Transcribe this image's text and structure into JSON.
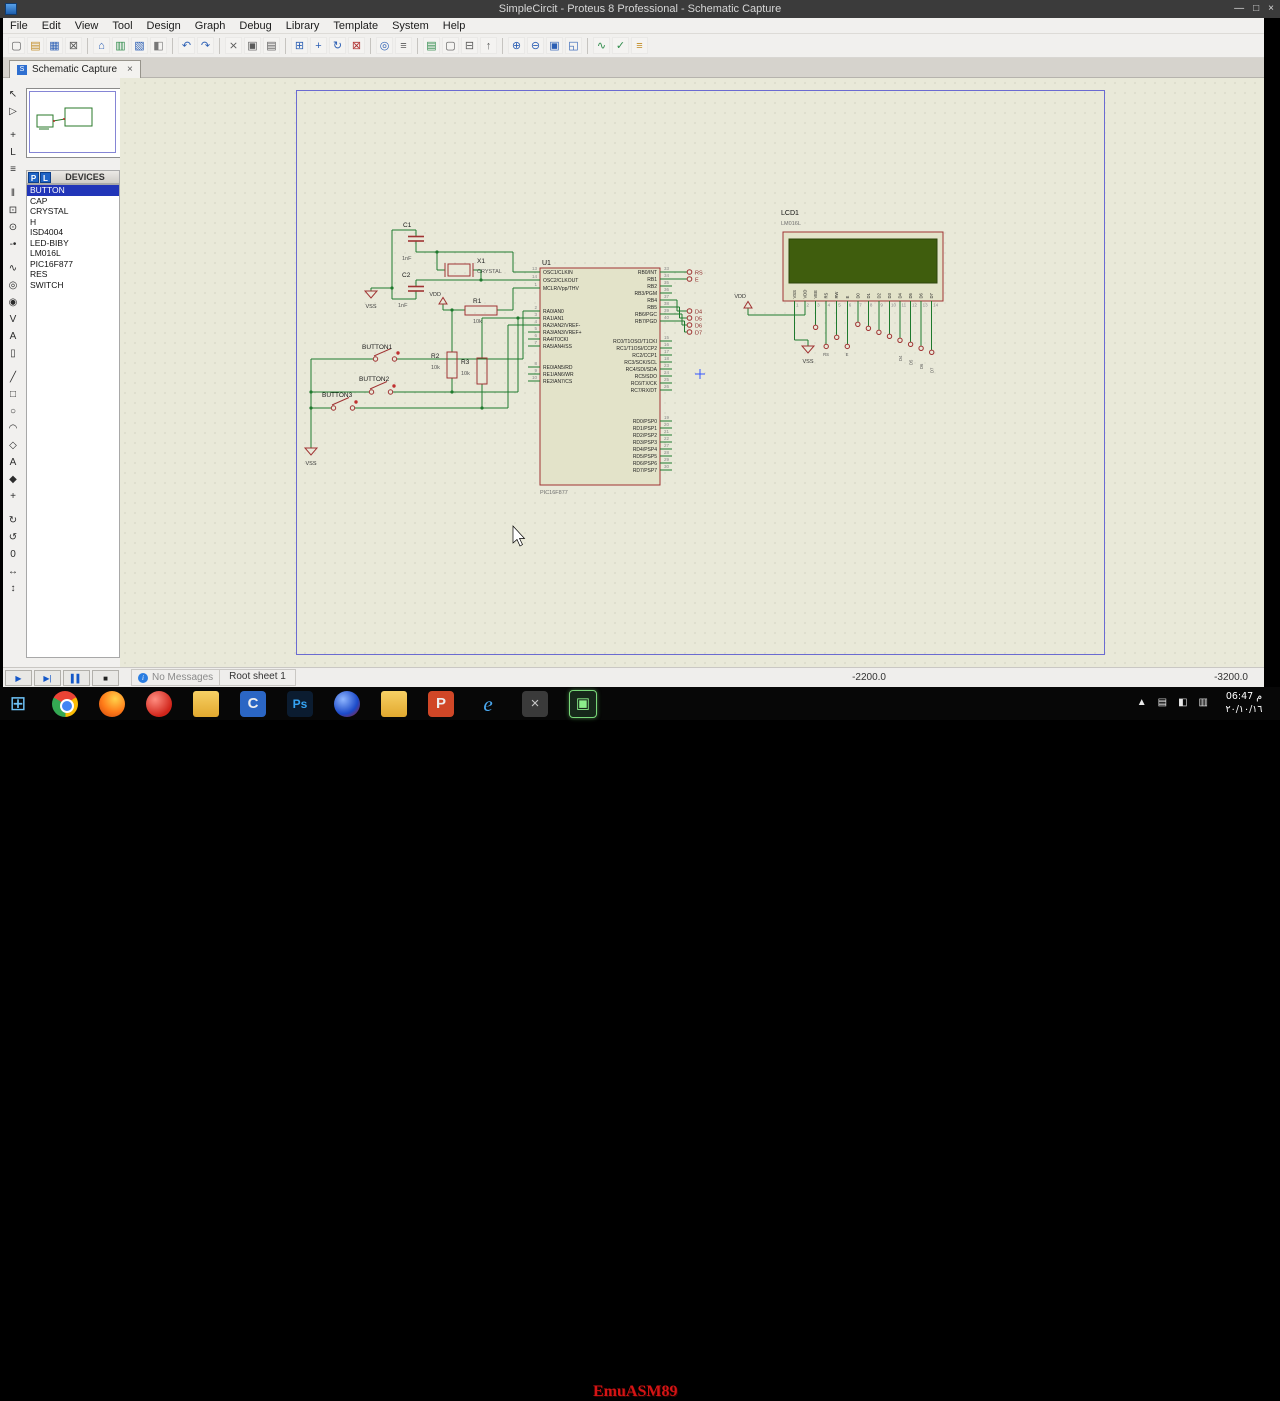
{
  "window": {
    "title": "SimpleCircit - Proteus 8 Professional - Schematic Capture",
    "controls": [
      {
        "n": "minimize",
        "g": "—"
      },
      {
        "n": "maximize",
        "g": "□"
      },
      {
        "n": "close",
        "g": "×"
      }
    ]
  },
  "menu": {
    "items": [
      "File",
      "Edit",
      "View",
      "Tool",
      "Design",
      "Graph",
      "Debug",
      "Library",
      "Template",
      "System",
      "Help"
    ]
  },
  "toolbar": {
    "groups": [
      [
        {
          "n": "new-project",
          "g": "▢",
          "c": "#5a5a5a"
        },
        {
          "n": "open-project",
          "g": "▤",
          "c": "#c08a20"
        },
        {
          "n": "save-project",
          "g": "▦",
          "c": "#2b5fb4"
        },
        {
          "n": "close-project",
          "g": "⊠",
          "c": "#5a5a5a"
        }
      ],
      [
        {
          "n": "home-page",
          "g": "⌂",
          "c": "#2b5fb4"
        },
        {
          "n": "schematic-capture-view",
          "g": "▥",
          "c": "#2e8b4a"
        },
        {
          "n": "pcb-layout-view",
          "g": "▧",
          "c": "#2b5fb4"
        },
        {
          "n": "3d-visualizer",
          "g": "◧",
          "c": "#777777"
        }
      ],
      [
        {
          "n": "undo",
          "g": "↶",
          "c": "#2b5fb4"
        },
        {
          "n": "redo",
          "g": "↷",
          "c": "#2b5fb4"
        }
      ],
      [
        {
          "n": "cut",
          "g": "⨯",
          "c": "#5a5a5a"
        },
        {
          "n": "copy",
          "g": "▣",
          "c": "#5a5a5a"
        },
        {
          "n": "paste",
          "g": "▤",
          "c": "#5a5a5a"
        }
      ],
      [
        {
          "n": "block-copy",
          "g": "⊞",
          "c": "#2b5fb4"
        },
        {
          "n": "block-move",
          "g": "+",
          "c": "#2b5fb4"
        },
        {
          "n": "block-rotate",
          "g": "↻",
          "c": "#2b5fb4"
        },
        {
          "n": "block-delete",
          "g": "⊠",
          "c": "#b03030"
        }
      ],
      [
        {
          "n": "search",
          "g": "◎",
          "c": "#2b5fb4"
        },
        {
          "n": "property-assignment",
          "g": "≡",
          "c": "#5a5a5a"
        }
      ],
      [
        {
          "n": "design-explorer",
          "g": "▤",
          "c": "#2e8b4a"
        },
        {
          "n": "new-sheet",
          "g": "▢",
          "c": "#5a5a5a"
        },
        {
          "n": "remove-sheet",
          "g": "⊟",
          "c": "#5a5a5a"
        },
        {
          "n": "exit-to-parent",
          "g": "↑",
          "c": "#5a5a5a"
        }
      ],
      [
        {
          "n": "zoom-in",
          "g": "⊕",
          "c": "#2b5fb4"
        },
        {
          "n": "zoom-out",
          "g": "⊖",
          "c": "#2b5fb4"
        },
        {
          "n": "zoom-extents",
          "g": "▣",
          "c": "#2b5fb4"
        },
        {
          "n": "zoom-area",
          "g": "◱",
          "c": "#2b5fb4"
        }
      ],
      [
        {
          "n": "wire-autorouter",
          "g": "∿",
          "c": "#2e8b4a"
        },
        {
          "n": "electrical-check",
          "g": "✓",
          "c": "#2e8b4a"
        },
        {
          "n": "bill-of-materials",
          "g": "≡",
          "c": "#c08a20"
        }
      ]
    ]
  },
  "tab": {
    "label": "Schematic Capture",
    "close": "×",
    "icon": "S"
  },
  "sidebar": {
    "pick_label": "P",
    "library_label": "L",
    "header": "DEVICES",
    "selected": "BUTTON",
    "devices": [
      "BUTTON",
      "CAP",
      "CRYSTAL",
      "H",
      "ISD4004",
      "LED-BIBY",
      "LM016L",
      "PIC16F877",
      "RES",
      "SWITCH"
    ],
    "mode_groups": [
      [
        {
          "n": "selection-mode",
          "g": "↖"
        },
        {
          "n": "component-mode",
          "g": "▷"
        }
      ],
      [
        {
          "n": "junction-dot-mode",
          "g": "+"
        },
        {
          "n": "wire-label-mode",
          "g": "L"
        },
        {
          "n": "text-script-mode",
          "g": "≡"
        }
      ],
      [
        {
          "n": "buses-mode",
          "g": "‖"
        },
        {
          "n": "subcircuit-mode",
          "g": "⊡"
        },
        {
          "n": "terminals-mode",
          "g": "⊙"
        },
        {
          "n": "device-pins-mode",
          "g": "-•"
        }
      ],
      [
        {
          "n": "graph-mode",
          "g": "∿"
        },
        {
          "n": "tape-recorder-mode",
          "g": "◎"
        },
        {
          "n": "generator-mode",
          "g": "◉"
        },
        {
          "n": "voltage-probe-mode",
          "g": "V"
        },
        {
          "n": "current-probe-mode",
          "g": "A"
        },
        {
          "n": "instruments-mode",
          "g": "▯"
        }
      ],
      [
        {
          "n": "2d-line-mode",
          "g": "╱"
        },
        {
          "n": "2d-box-mode",
          "g": "□"
        },
        {
          "n": "2d-circle-mode",
          "g": "○"
        },
        {
          "n": "2d-arc-mode",
          "g": "◠"
        },
        {
          "n": "2d-path-mode",
          "g": "◇"
        },
        {
          "n": "2d-text-mode",
          "g": "A"
        },
        {
          "n": "2d-symbol-mode",
          "g": "◆"
        },
        {
          "n": "2d-marker-mode",
          "g": "+"
        }
      ],
      [
        {
          "n": "rotate-clockwise",
          "g": "↻"
        },
        {
          "n": "rotate-anticlockwise",
          "g": "↺"
        },
        {
          "n": "rotation-angle-display",
          "g": "0"
        },
        {
          "n": "mirror-horizontal",
          "g": "↔"
        },
        {
          "n": "mirror-vertical",
          "g": "↕"
        }
      ]
    ]
  },
  "schematic": {
    "components": {
      "c1": {
        "ref": "C1",
        "value": "1nF"
      },
      "c2": {
        "ref": "C2",
        "value": "1nF"
      },
      "x1": {
        "ref": "X1",
        "value": "CRYSTAL"
      },
      "r1": {
        "ref": "R1",
        "value": "10k"
      },
      "r2": {
        "ref": "R2",
        "value": "10k"
      },
      "r3": {
        "ref": "R3",
        "value": "10k"
      },
      "b1": {
        "ref": "BUTTON1"
      },
      "b2": {
        "ref": "BUTTON2"
      },
      "b3": {
        "ref": "BUTTON3"
      },
      "u1": {
        "ref": "U1",
        "value": "PIC16F877"
      },
      "lcd1": {
        "ref": "LCD1",
        "value": "LM016L"
      }
    },
    "power": {
      "vss": "VSS",
      "vdd": "VDD"
    },
    "u1_pins_left": [
      {
        "num": "13",
        "name": "OSC1/CLKIN"
      },
      {
        "num": "14",
        "name": "OSC2/CLKOUT"
      },
      {
        "num": "1",
        "name": "MCLR/Vpp/THV"
      },
      {
        "num": "2",
        "name": "RA0/AN0"
      },
      {
        "num": "3",
        "name": "RA1/AN1"
      },
      {
        "num": "4",
        "name": "RA2/AN2/VREF-"
      },
      {
        "num": "5",
        "name": "RA3/AN3/VREF+"
      },
      {
        "num": "6",
        "name": "RA4/T0CKI"
      },
      {
        "num": "7",
        "name": "RA5/AN4/SS"
      },
      {
        "num": "8",
        "name": "RE0/AN5/RD"
      },
      {
        "num": "9",
        "name": "RE1/AN6/WR"
      },
      {
        "num": "10",
        "name": "RE2/AN7/CS"
      }
    ],
    "u1_pins_right": [
      {
        "num": "33",
        "name": "RB0/INT"
      },
      {
        "num": "34",
        "name": "RB1"
      },
      {
        "num": "35",
        "name": "RB2"
      },
      {
        "num": "36",
        "name": "RB3/PGM"
      },
      {
        "num": "37",
        "name": "RB4"
      },
      {
        "num": "38",
        "name": "RB5"
      },
      {
        "num": "39",
        "name": "RB6/PGC"
      },
      {
        "num": "40",
        "name": "RB7/PGD"
      },
      {
        "num": "15",
        "name": "RC0/T1OSO/T1CKI"
      },
      {
        "num": "16",
        "name": "RC1/T1OSI/CCP2"
      },
      {
        "num": "17",
        "name": "RC2/CCP1"
      },
      {
        "num": "18",
        "name": "RC3/SCK/SCL"
      },
      {
        "num": "23",
        "name": "RC4/SDI/SDA"
      },
      {
        "num": "24",
        "name": "RC5/SDO"
      },
      {
        "num": "25",
        "name": "RC6/TX/CK"
      },
      {
        "num": "26",
        "name": "RC7/RX/DT"
      },
      {
        "num": "19",
        "name": "RD0/PSP0"
      },
      {
        "num": "20",
        "name": "RD1/PSP1"
      },
      {
        "num": "21",
        "name": "RD2/PSP2"
      },
      {
        "num": "22",
        "name": "RD3/PSP3"
      },
      {
        "num": "27",
        "name": "RD4/PSP4"
      },
      {
        "num": "28",
        "name": "RD5/PSP5"
      },
      {
        "num": "29",
        "name": "RD6/PSP6"
      },
      {
        "num": "30",
        "name": "RD7/PSP7"
      }
    ],
    "u1_wire_labels": [
      "RS",
      "E",
      "D4",
      "D5",
      "D6",
      "D7"
    ],
    "lcd_pins": [
      "VSS",
      "VDD",
      "VEE",
      "RS",
      "RW",
      "E",
      "D0",
      "D1",
      "D2",
      "D3",
      "D4",
      "D5",
      "D6",
      "D7"
    ],
    "lcd_wire_labels": [
      "RS",
      "E",
      "D4",
      "D5",
      "D6",
      "D7"
    ]
  },
  "status_bar": {
    "sim": [
      {
        "n": "play-button",
        "g": "▶",
        "c": "#1457c8"
      },
      {
        "n": "step-button",
        "g": "▶|",
        "c": "#1457c8"
      },
      {
        "n": "pause-button",
        "g": "▌▌",
        "c": "#1457c8"
      },
      {
        "n": "stop-button",
        "g": "■",
        "c": "#222222"
      }
    ],
    "info_glyph": "i",
    "message": "No Messages",
    "sheet": "Root sheet 1",
    "coord_x": "-2200.0",
    "coord_y": "-3200.0"
  },
  "taskbar": {
    "icons": [
      {
        "n": "start-button",
        "g": "⊞",
        "cls": "start"
      },
      {
        "n": "chrome",
        "cls": "chrome"
      },
      {
        "n": "firefox",
        "cls": "ff"
      },
      {
        "n": "app-red-orb",
        "cls": "redorb"
      },
      {
        "n": "file-explorer",
        "cls": "folder"
      },
      {
        "n": "dev-cpp",
        "g": "C",
        "cls": "devc"
      },
      {
        "n": "photoshop",
        "g": "Ps",
        "cls": "ps"
      },
      {
        "n": "opera-orb",
        "cls": "orb2"
      },
      {
        "n": "documents-folder",
        "cls": "folder"
      },
      {
        "n": "powerpoint",
        "g": "P",
        "cls": "pp"
      },
      {
        "n": "internet-explorer",
        "g": "e",
        "cls": "ie"
      },
      {
        "n": "close-app",
        "g": "×",
        "cls": "xicon"
      },
      {
        "n": "emuasm-window",
        "g": "▣",
        "cls": "emuasm"
      }
    ],
    "tray": [
      "▲",
      "▤",
      "◧",
      "▥"
    ],
    "watermark": "EmuASM89",
    "clock": {
      "time": "06:47 م",
      "date": "٢٠/١٠/١٦"
    }
  }
}
